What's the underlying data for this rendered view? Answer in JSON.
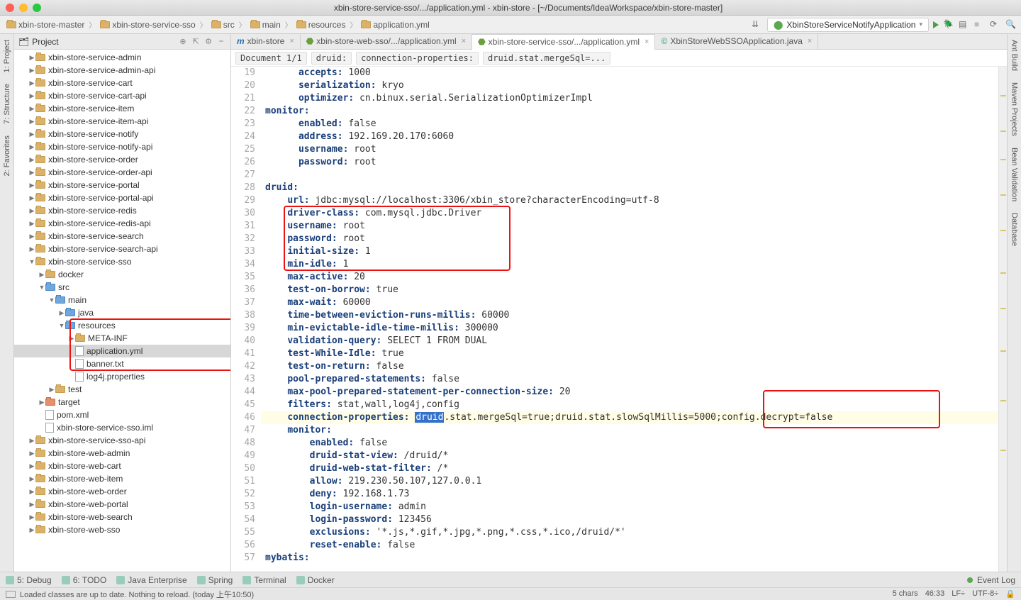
{
  "title": "xbin-store-service-sso/.../application.yml - xbin-store - [~/Documents/IdeaWorkspace/xbin-store-master]",
  "breadcrumbs": [
    "xbin-store-master",
    "xbin-store-service-sso",
    "src",
    "main",
    "resources",
    "application.yml"
  ],
  "run_config": "XbinStoreServiceNotifyApplication",
  "side_left": [
    "1: Project",
    "7: Structure",
    "2: Favorites"
  ],
  "side_right": [
    "Ant Build",
    "Maven Projects",
    "Bean Validation",
    "Database"
  ],
  "proj_header": "Project",
  "tree": [
    {
      "d": 1,
      "t": "mod",
      "n": "xbin-store-service-admin",
      "tw": "▶"
    },
    {
      "d": 1,
      "t": "mod",
      "n": "xbin-store-service-admin-api",
      "tw": "▶"
    },
    {
      "d": 1,
      "t": "mod",
      "n": "xbin-store-service-cart",
      "tw": "▶"
    },
    {
      "d": 1,
      "t": "mod",
      "n": "xbin-store-service-cart-api",
      "tw": "▶"
    },
    {
      "d": 1,
      "t": "mod",
      "n": "xbin-store-service-item",
      "tw": "▶"
    },
    {
      "d": 1,
      "t": "mod",
      "n": "xbin-store-service-item-api",
      "tw": "▶"
    },
    {
      "d": 1,
      "t": "mod",
      "n": "xbin-store-service-notify",
      "tw": "▶"
    },
    {
      "d": 1,
      "t": "mod",
      "n": "xbin-store-service-notify-api",
      "tw": "▶"
    },
    {
      "d": 1,
      "t": "mod",
      "n": "xbin-store-service-order",
      "tw": "▶"
    },
    {
      "d": 1,
      "t": "mod",
      "n": "xbin-store-service-order-api",
      "tw": "▶"
    },
    {
      "d": 1,
      "t": "mod",
      "n": "xbin-store-service-portal",
      "tw": "▶"
    },
    {
      "d": 1,
      "t": "mod",
      "n": "xbin-store-service-portal-api",
      "tw": "▶"
    },
    {
      "d": 1,
      "t": "mod",
      "n": "xbin-store-service-redis",
      "tw": "▶"
    },
    {
      "d": 1,
      "t": "mod",
      "n": "xbin-store-service-redis-api",
      "tw": "▶"
    },
    {
      "d": 1,
      "t": "mod",
      "n": "xbin-store-service-search",
      "tw": "▶"
    },
    {
      "d": 1,
      "t": "mod",
      "n": "xbin-store-service-search-api",
      "tw": "▶"
    },
    {
      "d": 1,
      "t": "mod",
      "n": "xbin-store-service-sso",
      "tw": "▼"
    },
    {
      "d": 2,
      "t": "dir",
      "n": "docker",
      "tw": "▶"
    },
    {
      "d": 2,
      "t": "srcdir",
      "n": "src",
      "tw": "▼"
    },
    {
      "d": 3,
      "t": "srcdir",
      "n": "main",
      "tw": "▼"
    },
    {
      "d": 4,
      "t": "srcdir",
      "n": "java",
      "tw": "▶"
    },
    {
      "d": 4,
      "t": "resdir",
      "n": "resources",
      "tw": "▼",
      "box": "start"
    },
    {
      "d": 5,
      "t": "dir",
      "n": "META-INF",
      "tw": "▶"
    },
    {
      "d": 5,
      "t": "file",
      "n": "application.yml",
      "tw": "",
      "sel": true
    },
    {
      "d": 5,
      "t": "file",
      "n": "banner.txt",
      "tw": "",
      "box": "end"
    },
    {
      "d": 5,
      "t": "file",
      "n": "log4j.properties",
      "tw": ""
    },
    {
      "d": 3,
      "t": "dir",
      "n": "test",
      "tw": "▶"
    },
    {
      "d": 2,
      "t": "tgt",
      "n": "target",
      "tw": "▶"
    },
    {
      "d": 2,
      "t": "file",
      "n": "pom.xml",
      "tw": ""
    },
    {
      "d": 2,
      "t": "file",
      "n": "xbin-store-service-sso.iml",
      "tw": ""
    },
    {
      "d": 1,
      "t": "mod",
      "n": "xbin-store-service-sso-api",
      "tw": "▶"
    },
    {
      "d": 1,
      "t": "mod",
      "n": "xbin-store-web-admin",
      "tw": "▶"
    },
    {
      "d": 1,
      "t": "mod",
      "n": "xbin-store-web-cart",
      "tw": "▶"
    },
    {
      "d": 1,
      "t": "mod",
      "n": "xbin-store-web-item",
      "tw": "▶"
    },
    {
      "d": 1,
      "t": "mod",
      "n": "xbin-store-web-order",
      "tw": "▶"
    },
    {
      "d": 1,
      "t": "mod",
      "n": "xbin-store-web-portal",
      "tw": "▶"
    },
    {
      "d": 1,
      "t": "mod",
      "n": "xbin-store-web-search",
      "tw": "▶"
    },
    {
      "d": 1,
      "t": "mod",
      "n": "xbin-store-web-sso",
      "tw": "▶"
    }
  ],
  "tabs": [
    {
      "label": "xbin-store",
      "icon": "m"
    },
    {
      "label": "xbin-store-web-sso/.../application.yml",
      "icon": "yml"
    },
    {
      "label": "xbin-store-service-sso/.../application.yml",
      "icon": "yml",
      "active": true
    },
    {
      "label": "XbinStoreWebSSOApplication.java",
      "icon": "java"
    }
  ],
  "crumb_boxes": [
    "Document 1/1",
    "druid:",
    "connection-properties:",
    "druid.stat.mergeSql=..."
  ],
  "code_start": 19,
  "code": [
    [
      [
        "      "
      ],
      [
        "k",
        "accepts:"
      ],
      [
        " 1000"
      ]
    ],
    [
      [
        "      "
      ],
      [
        "k",
        "serialization:"
      ],
      [
        " kryo"
      ]
    ],
    [
      [
        "      "
      ],
      [
        "k",
        "optimizer:"
      ],
      [
        " cn.binux.serial.SerializationOptimizerImpl"
      ]
    ],
    [
      [
        "k",
        "monitor:"
      ]
    ],
    [
      [
        "      "
      ],
      [
        "k",
        "enabled:"
      ],
      [
        " false"
      ]
    ],
    [
      [
        "      "
      ],
      [
        "k",
        "address:"
      ],
      [
        " 192.169.20.170:6060"
      ]
    ],
    [
      [
        "      "
      ],
      [
        "k",
        "username:"
      ],
      [
        " root"
      ]
    ],
    [
      [
        "      "
      ],
      [
        "k",
        "password:"
      ],
      [
        " root"
      ]
    ],
    [
      [
        ""
      ]
    ],
    [
      [
        "k",
        "druid:"
      ]
    ],
    [
      [
        "    "
      ],
      [
        "k",
        "url:"
      ],
      [
        " jdbc:mysql://localhost:3306/xbin_store?characterEncoding=utf-8"
      ]
    ],
    [
      [
        "    "
      ],
      [
        "k",
        "driver-class:"
      ],
      [
        " com.mysql.jdbc.Driver"
      ]
    ],
    [
      [
        "    "
      ],
      [
        "k",
        "username:"
      ],
      [
        " root"
      ]
    ],
    [
      [
        "    "
      ],
      [
        "k",
        "password:"
      ],
      [
        " root"
      ]
    ],
    [
      [
        "    "
      ],
      [
        "k",
        "initial-size:"
      ],
      [
        " 1"
      ]
    ],
    [
      [
        "    "
      ],
      [
        "k",
        "min-idle:"
      ],
      [
        " 1"
      ]
    ],
    [
      [
        "    "
      ],
      [
        "k",
        "max-active:"
      ],
      [
        " 20"
      ]
    ],
    [
      [
        "    "
      ],
      [
        "k",
        "test-on-borrow:"
      ],
      [
        " true"
      ]
    ],
    [
      [
        "    "
      ],
      [
        "k",
        "max-wait:"
      ],
      [
        " 60000"
      ]
    ],
    [
      [
        "    "
      ],
      [
        "k",
        "time-between-eviction-runs-millis:"
      ],
      [
        " 60000"
      ]
    ],
    [
      [
        "    "
      ],
      [
        "k",
        "min-evictable-idle-time-millis:"
      ],
      [
        " 300000"
      ]
    ],
    [
      [
        "    "
      ],
      [
        "k",
        "validation-query:"
      ],
      [
        " SELECT 1 FROM DUAL"
      ]
    ],
    [
      [
        "    "
      ],
      [
        "k",
        "test-While-Idle:"
      ],
      [
        " true"
      ]
    ],
    [
      [
        "    "
      ],
      [
        "k",
        "test-on-return:"
      ],
      [
        " false"
      ]
    ],
    [
      [
        "    "
      ],
      [
        "k",
        "pool-prepared-statements:"
      ],
      [
        " false"
      ]
    ],
    [
      [
        "    "
      ],
      [
        "k",
        "max-pool-prepared-statement-per-connection-size:"
      ],
      [
        " 20"
      ]
    ],
    [
      [
        "    "
      ],
      [
        "k",
        "filters:"
      ],
      [
        " stat,wall,log4j,config"
      ]
    ],
    [
      [
        "    "
      ],
      [
        "k",
        "connection-properties:"
      ],
      [
        " "
      ],
      [
        "sel",
        "druid"
      ],
      [
        ".stat.mergeSql=true;druid.stat.slowSqlMillis=5000;config.decrypt=false"
      ]
    ],
    [
      [
        "    "
      ],
      [
        "k",
        "monitor:"
      ]
    ],
    [
      [
        "        "
      ],
      [
        "k",
        "enabled:"
      ],
      [
        " false"
      ]
    ],
    [
      [
        "        "
      ],
      [
        "k",
        "druid-stat-view:"
      ],
      [
        " /druid/*"
      ]
    ],
    [
      [
        "        "
      ],
      [
        "k",
        "druid-web-stat-filter:"
      ],
      [
        " /*"
      ]
    ],
    [
      [
        "        "
      ],
      [
        "k",
        "allow:"
      ],
      [
        " 219.230.50.107,127.0.0.1"
      ]
    ],
    [
      [
        "        "
      ],
      [
        "k",
        "deny:"
      ],
      [
        " 192.168.1.73"
      ]
    ],
    [
      [
        "        "
      ],
      [
        "k",
        "login-username:"
      ],
      [
        " admin"
      ]
    ],
    [
      [
        "        "
      ],
      [
        "k",
        "login-password:"
      ],
      [
        " 123456"
      ]
    ],
    [
      [
        "        "
      ],
      [
        "k",
        "exclusions:"
      ],
      [
        " '*.js,*.gif,*.jpg,*.png,*.css,*.ico,/druid/*'"
      ]
    ],
    [
      [
        "        "
      ],
      [
        "k",
        "reset-enable:"
      ],
      [
        " false"
      ]
    ],
    [
      [
        "k",
        "mybatis:"
      ]
    ]
  ],
  "bottom": [
    "5: Debug",
    "6: TODO",
    "Java Enterprise",
    "Spring",
    "Terminal",
    "Docker"
  ],
  "event_log": "Event Log",
  "status_msg": "Loaded classes are up to date. Nothing to reload. (today 上午10:50)",
  "status_right": {
    "chars": "5 chars",
    "pos": "46:33",
    "le": "LF÷",
    "enc": "UTF-8÷"
  },
  "watermark": ""
}
